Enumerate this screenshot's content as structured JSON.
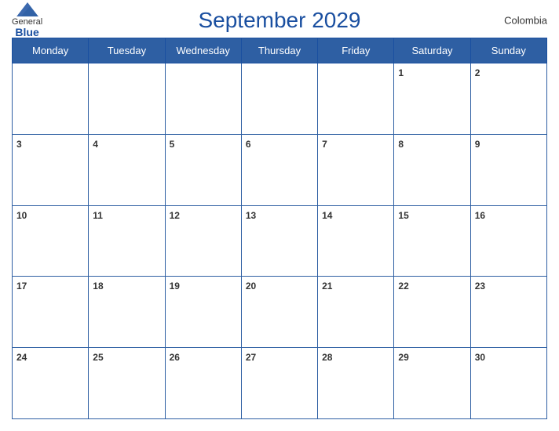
{
  "header": {
    "logo_general": "General",
    "logo_blue": "Blue",
    "title": "September 2029",
    "country": "Colombia"
  },
  "calendar": {
    "days_of_week": [
      "Monday",
      "Tuesday",
      "Wednesday",
      "Thursday",
      "Friday",
      "Saturday",
      "Sunday"
    ],
    "weeks": [
      [
        {
          "date": "",
          "empty": true
        },
        {
          "date": "",
          "empty": true
        },
        {
          "date": "",
          "empty": true
        },
        {
          "date": "",
          "empty": true
        },
        {
          "date": "",
          "empty": true
        },
        {
          "date": "1",
          "empty": false
        },
        {
          "date": "2",
          "empty": false
        }
      ],
      [
        {
          "date": "3",
          "empty": false
        },
        {
          "date": "4",
          "empty": false
        },
        {
          "date": "5",
          "empty": false
        },
        {
          "date": "6",
          "empty": false
        },
        {
          "date": "7",
          "empty": false
        },
        {
          "date": "8",
          "empty": false
        },
        {
          "date": "9",
          "empty": false
        }
      ],
      [
        {
          "date": "10",
          "empty": false
        },
        {
          "date": "11",
          "empty": false
        },
        {
          "date": "12",
          "empty": false
        },
        {
          "date": "13",
          "empty": false
        },
        {
          "date": "14",
          "empty": false
        },
        {
          "date": "15",
          "empty": false
        },
        {
          "date": "16",
          "empty": false
        }
      ],
      [
        {
          "date": "17",
          "empty": false
        },
        {
          "date": "18",
          "empty": false
        },
        {
          "date": "19",
          "empty": false
        },
        {
          "date": "20",
          "empty": false
        },
        {
          "date": "21",
          "empty": false
        },
        {
          "date": "22",
          "empty": false
        },
        {
          "date": "23",
          "empty": false
        }
      ],
      [
        {
          "date": "24",
          "empty": false
        },
        {
          "date": "25",
          "empty": false
        },
        {
          "date": "26",
          "empty": false
        },
        {
          "date": "27",
          "empty": false
        },
        {
          "date": "28",
          "empty": false
        },
        {
          "date": "29",
          "empty": false
        },
        {
          "date": "30",
          "empty": false
        }
      ]
    ]
  }
}
